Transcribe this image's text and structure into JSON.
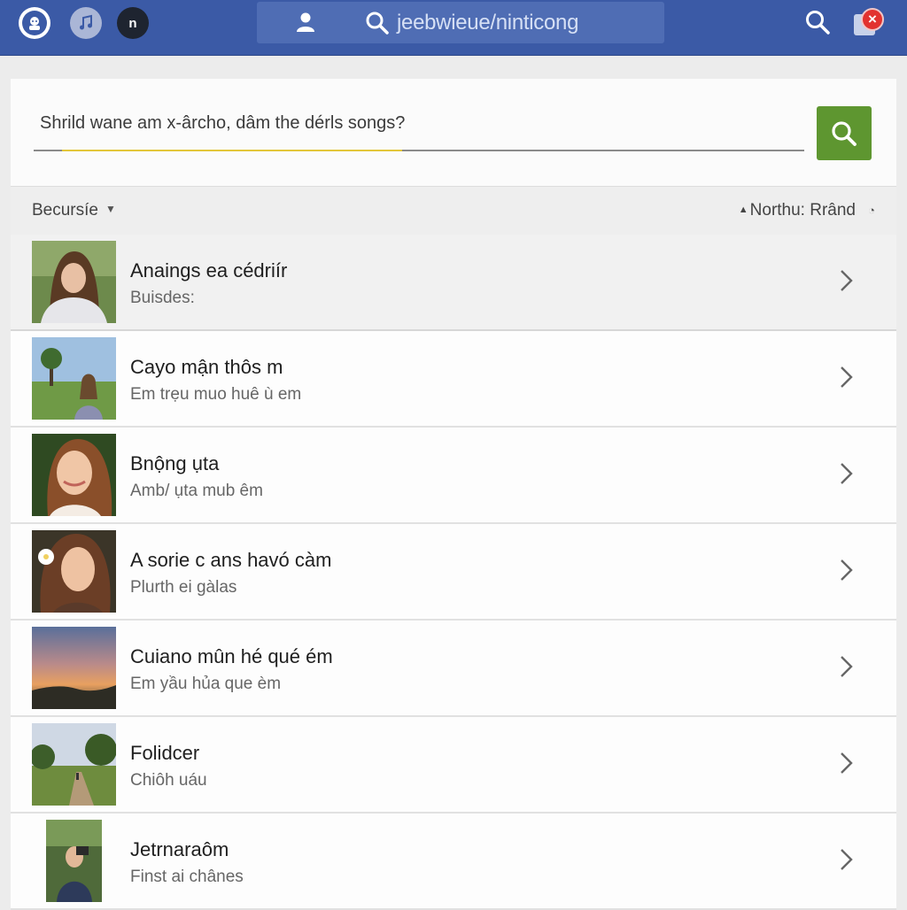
{
  "topbar": {
    "search_text": "jeebwieue/ninticong",
    "n_label": "n",
    "notification_badge": "×"
  },
  "search": {
    "query": "Shrild wane am x-ârcho, dâm the dérls songs?"
  },
  "sort": {
    "left_label": "Becursíe",
    "right_label": "Northu: Rrând"
  },
  "songs": [
    {
      "title": "Anaings ea cédriír",
      "subtitle": "Buisdes:",
      "thumb": "portrait-woman-hair-down"
    },
    {
      "title": "Cayo mận thôs m",
      "subtitle": "Em trẹu muo huê ù em",
      "thumb": "woman-in-field"
    },
    {
      "title": "Bnộng ụta",
      "subtitle": "Amb/ ụta mub êm",
      "thumb": "portrait-woman-smiling"
    },
    {
      "title": "A sorie c ans havó càm",
      "subtitle": "Plurth ei gàlas",
      "thumb": "portrait-woman-flower"
    },
    {
      "title": "Cuiano mûn hé qué ém",
      "subtitle": "Em yầu hủa que èm",
      "thumb": "sunset-landscape"
    },
    {
      "title": "Folidcer",
      "subtitle": "Chiôh uáu",
      "thumb": "country-road"
    },
    {
      "title": "Jetrnaraôm",
      "subtitle": "Finst ai chânes",
      "thumb": "person-taking-photo"
    }
  ],
  "colors": {
    "topbar": "#3b5aa6",
    "search_button": "#5e9630",
    "focus_underline": "#e3c63a",
    "badge": "#e2322f"
  }
}
